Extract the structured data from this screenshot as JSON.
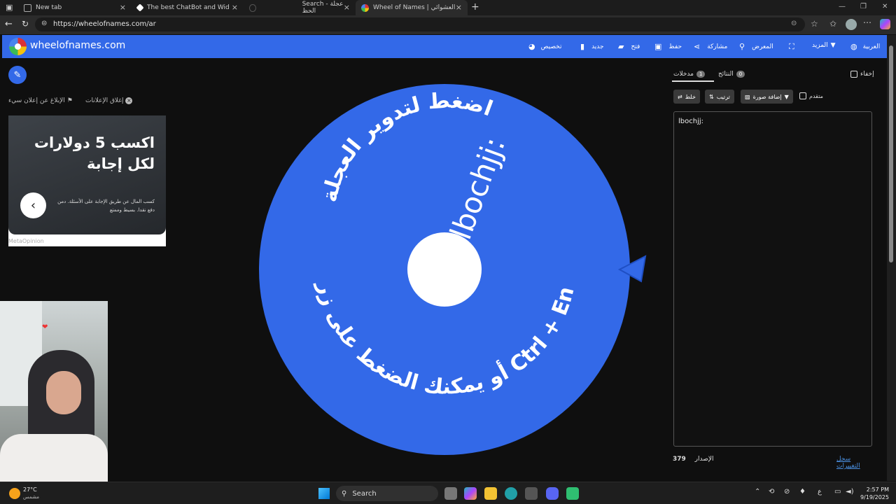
{
  "browser": {
    "tabs": [
      {
        "title": "New tab",
        "active": false
      },
      {
        "title": "The best ChatBot and Widgets fo",
        "active": false
      },
      {
        "title": "Search - عجلة الحظ",
        "active": false
      },
      {
        "title": "Wheel of Names | الاسم العشوائي",
        "active": true
      }
    ],
    "url": "https://wheelofnames.com/ar"
  },
  "header": {
    "site_name": "wheelofnames.com",
    "items": {
      "customize": "تخصيص",
      "new": "جديد",
      "open": "فتح",
      "save": "حفظ",
      "share": "مشاركة",
      "gallery": "المعرض",
      "more": "المزيد",
      "language": "العربية"
    }
  },
  "ads": {
    "close_ads": "إغلاق الإعلانات",
    "report_ad": "الإبلاغ عن إعلان سيء",
    "ad_title": "اكسب 5 دولارات لكل إجابة",
    "ad_body": "كسب المال عن طريق الإجابة على الأسئلة. دمن دفع نقدا. بسيط وممتع",
    "ad_footer": "MetaOpinion"
  },
  "wheel": {
    "entry": "lbochjj:",
    "instruction_top": "اضغط لتدوير العجلة",
    "instruction_bottom": "أو يمكنك الضغط على زر Ctrl + Enter",
    "color": "#3369e8"
  },
  "panel": {
    "hide_label": "إخفاء",
    "tab_entries": "مدخلات",
    "tab_entries_count": "1",
    "tab_results": "النتائج",
    "tab_results_count": "0",
    "toolbar": {
      "shuffle": "خلط",
      "sort": "ترتيب",
      "add_image": "إضافة صورة",
      "advanced": "متقدم"
    },
    "entries_text": "lbochjj:",
    "version_label": "الإصدار",
    "version_number": "379",
    "changelog": "سجل التغييرات"
  },
  "taskbar": {
    "weather_temp": "27°C",
    "weather_desc": "مشمس",
    "search": "Search",
    "time": "2:57 PM",
    "date": "9/19/2025",
    "lang": "ع"
  }
}
